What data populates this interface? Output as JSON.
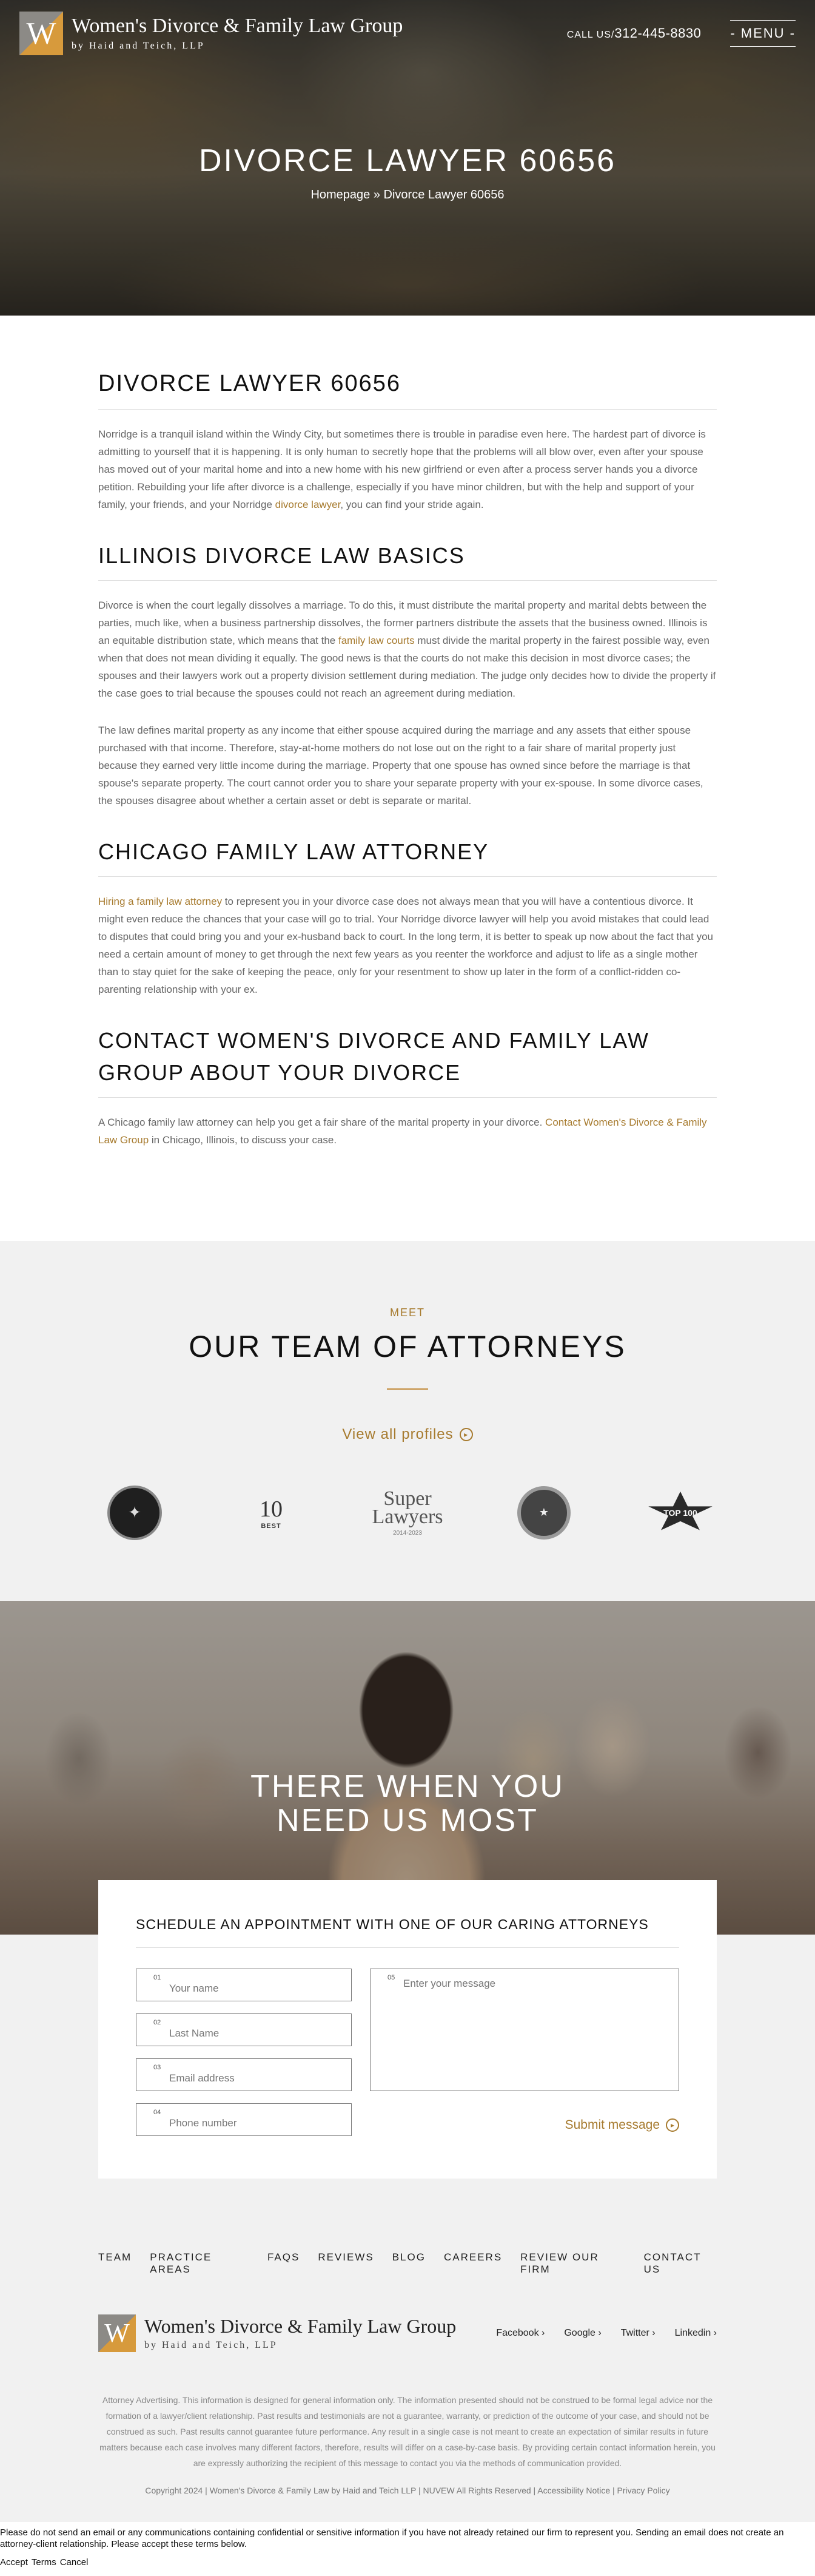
{
  "header": {
    "logo_letter": "W",
    "logo_name": "Women's Divorce & Family Law Group",
    "logo_sub": "by Haid and Teich, LLP",
    "call_label": "CALL US/",
    "phone": "312-445-8830",
    "menu_label": "- MENU -"
  },
  "hero": {
    "title": "DIVORCE LAWYER 60656",
    "breadcrumb_home": "Homepage",
    "breadcrumb_sep": "»",
    "breadcrumb_current": "Divorce Lawyer 60656"
  },
  "article": {
    "h1": "DIVORCE LAWYER 60656",
    "p1": "Norridge is a tranquil island within the Windy City, but sometimes there is trouble in paradise even here. The hardest part of divorce is admitting to yourself that it is happening. It is only human to secretly hope that the problems will all blow over, even after your spouse has moved out of your marital home and into a new home with his new girlfriend or even after a process server hands you a divorce petition. Rebuilding your life after divorce is a challenge, especially if you have minor children, but with the help and support of your family, your friends, and your Norridge ",
    "p1_link": "divorce lawyer",
    "p1_end": ", you can find your stride again.",
    "h2_basics": "ILLINOIS DIVORCE LAW BASICS",
    "p2a": "Divorce is when the court legally dissolves a marriage. To do this, it must distribute the marital property and marital debts between the parties, much like, when a business partnership dissolves, the former partners distribute the assets that the business owned. Illinois is an equitable distribution state, which means that the ",
    "p2_link": "family law courts",
    "p2b": " must divide the marital property in the fairest possible way, even when that does not mean dividing it equally. The good news is that the courts do not make this decision in most divorce cases; the spouses and their lawyers work out a property division settlement during mediation. The judge only decides how to divide the property if the case goes to trial because the spouses could not reach an agreement during mediation.",
    "p3": "The law defines marital property as any income that either spouse acquired during the marriage and any assets that either spouse purchased with that income. Therefore, stay-at-home mothers do not lose out on the right to a fair share of marital property just because they earned very little income during the marriage. Property that one spouse has owned since before the marriage is that spouse's separate property. The court cannot order you to share your separate property with your ex-spouse. In some divorce cases, the spouses disagree about whether a certain asset or debt is separate or marital.",
    "h2_chicago": "CHICAGO FAMILY LAW ATTORNEY",
    "p4_link": "Hiring a family law attorney",
    "p4": " to represent you in your divorce case does not always mean that you will have a contentious divorce. It might even reduce the chances that your case will go to trial. Your Norridge divorce lawyer will help you avoid mistakes that could lead to disputes that could bring you and your ex-husband back to court. In the long term, it is better to speak up now about the fact that you need a certain amount of money to get through the next few years as you reenter the workforce and adjust to life as a single mother than to stay quiet for the sake of keeping the peace, only for your resentment to show up later in the form of a conflict-ridden co-parenting relationship with your ex.",
    "h2_contact": "CONTACT WOMEN'S DIVORCE AND FAMILY LAW GROUP ABOUT YOUR DIVORCE",
    "p5": "A Chicago family law attorney can help you get a fair share of the marital property in your divorce. ",
    "p5_link": "Contact Women's Divorce & Family Law Group",
    "p5_end": " in Chicago, Illinois, to discuss your case."
  },
  "team": {
    "meet": "MEET",
    "title": "OUR TEAM OF ATTORNEYS",
    "view_all": "View all profiles",
    "badge_ten_num": "10",
    "badge_ten_text": "BEST",
    "badge_super": "Super Lawyers",
    "badge_super_years": "2014-2023",
    "badge_top": "TOP 100"
  },
  "need": {
    "title_line1": "THERE WHEN YOU",
    "title_line2": "NEED US MOST"
  },
  "appointment": {
    "title": "SCHEDULE AN APPOINTMENT WITH ONE OF OUR CARING ATTORNEYS",
    "fields": [
      {
        "no": "01",
        "placeholder": "Your name"
      },
      {
        "no": "02",
        "placeholder": "Last Name"
      },
      {
        "no": "03",
        "placeholder": "Email address"
      },
      {
        "no": "04",
        "placeholder": "Phone number"
      }
    ],
    "message_no": "05",
    "message_placeholder": "Enter your message",
    "submit": "Submit message"
  },
  "footer": {
    "nav": [
      "TEAM",
      "PRACTICE AREAS",
      "FAQS",
      "REVIEWS",
      "BLOG",
      "CAREERS",
      "REVIEW OUR FIRM",
      "CONTACT US"
    ],
    "logo_letter": "W",
    "logo_name": "Women's Divorce & Family Law Group",
    "logo_sub": "by Haid and Teich, LLP",
    "social": [
      "Facebook ›",
      "Google ›",
      "Twitter ›",
      "Linkedin ›"
    ],
    "disclaimer": "Attorney Advertising. This information is designed for general information only. The information presented should not be construed to be formal legal advice nor the formation of a lawyer/client relationship. Past results and testimonials are not a guarantee, warranty, or prediction of the outcome of your case, and should not be construed as such. Past results cannot guarantee future performance. Any result in a single case is not meant to create an expectation of similar results in future matters because each case involves many different factors, therefore, results will differ on a case-by-case basis. By providing certain contact information herein, you are expressly authorizing the recipient of this message to contact you via the methods of communication provided.",
    "copyright": "Copyright 2024 | Women's Divorce & Family Law by Haid and Teich LLP | NUVEW All Rights Reserved | Accessibility Notice | Privacy Policy"
  },
  "cookie": {
    "text": "Please do not send an email or any communications containing confidential or sensitive information if you have not already retained our firm to represent you. Sending an email does not create an attorney-client relationship. Please accept these terms below.",
    "accept": "Accept",
    "terms": "Terms",
    "cancel": "Cancel"
  },
  "colors": {
    "accent": "#a77b2f",
    "rule": "#c28a3a",
    "section_bg": "#f1f1f1"
  }
}
